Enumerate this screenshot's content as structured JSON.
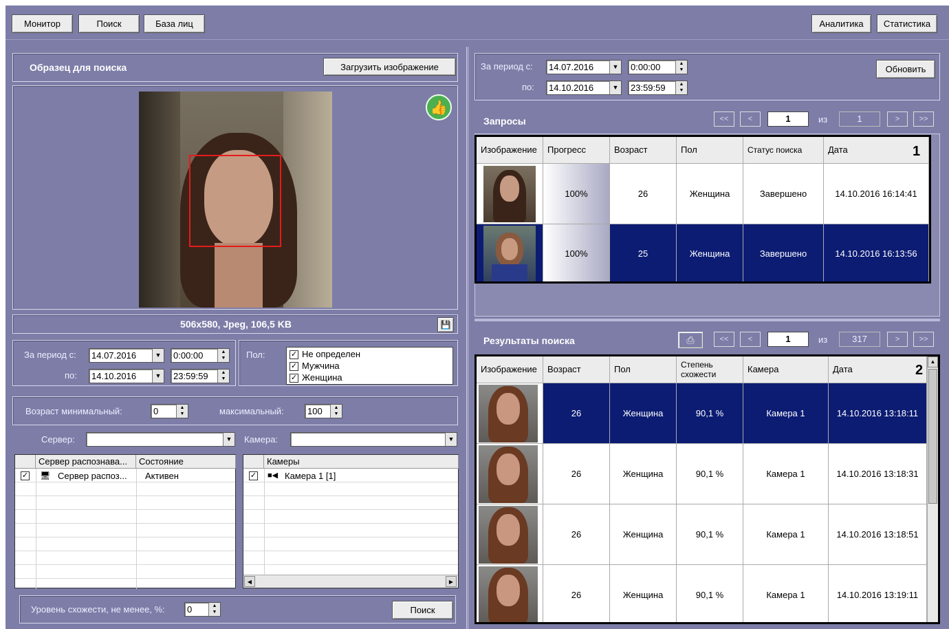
{
  "toolbar": {
    "monitor": "Монитор",
    "search": "Поиск",
    "face_base": "База лиц",
    "analytics": "Аналитика",
    "statistics": "Статистика"
  },
  "sample": {
    "title": "Образец для поиска",
    "load_button": "Загрузить изображение",
    "image_info": "506x580, Jpeg, 106,5 KB"
  },
  "left_filter": {
    "period_from_label": "За период с:",
    "date_from": "14.07.2016",
    "time_from": "0:00:00",
    "period_to_label": "по:",
    "date_to": "14.10.2016",
    "time_to": "23:59:59",
    "gender_label": "Пол:",
    "genders": [
      {
        "label": "Не определен",
        "checked": true
      },
      {
        "label": "Мужчина",
        "checked": true
      },
      {
        "label": "Женщина",
        "checked": true
      }
    ],
    "age_min_label": "Возраст минимальный:",
    "age_min": "0",
    "age_max_label": "максимальный:",
    "age_max": "100",
    "server_label": "Сервер:",
    "server_value": "",
    "camera_label": "Камера:",
    "camera_value": ""
  },
  "servers": {
    "col_server": "Сервер распознава...",
    "col_state": "Состояние",
    "rows": [
      {
        "name": "Сервер распоз...",
        "state": "Активен",
        "checked": true
      }
    ]
  },
  "cameras": {
    "col_cameras": "Камеры",
    "rows": [
      {
        "name": "Камера 1 [1]",
        "checked": true
      }
    ]
  },
  "similarity": {
    "label": "Уровень схожести, не менее, %:",
    "value": "0",
    "search_button": "Поиск"
  },
  "right_filter": {
    "period_from_label": "За период с:",
    "date_from": "14.07.2016",
    "time_from": "0:00:00",
    "period_to_label": "по:",
    "date_to": "14.10.2016",
    "time_to": "23:59:59",
    "refresh_button": "Обновить"
  },
  "requests": {
    "title": "Запросы",
    "pager": {
      "first": "<<",
      "prev": "<",
      "page": "1",
      "of": "из",
      "total": "1",
      "next": ">",
      "last": ">>"
    },
    "marker": "1",
    "columns": [
      "Изображение",
      "Прогресс",
      "Возраст",
      "Пол",
      "Статус поиска",
      "Дата"
    ],
    "rows": [
      {
        "progress": "100%",
        "age": "26",
        "gender": "Женщина",
        "status": "Завершено",
        "date": "14.10.2016 16:14:41",
        "selected": false
      },
      {
        "progress": "100%",
        "age": "25",
        "gender": "Женщина",
        "status": "Завершено",
        "date": "14.10.2016 16:13:56",
        "selected": true
      }
    ]
  },
  "results": {
    "title": "Результаты поиска",
    "pager": {
      "first": "<<",
      "prev": "<",
      "page": "1",
      "of": "из",
      "total": "317",
      "next": ">",
      "last": ">>"
    },
    "marker": "2",
    "columns": [
      "Изображение",
      "Возраст",
      "Пол",
      "Степень схожести",
      "Камера",
      "Дата"
    ],
    "rows": [
      {
        "age": "26",
        "gender": "Женщина",
        "similarity": "90,1 %",
        "camera": "Камера 1",
        "date": "14.10.2016 13:18:11",
        "selected": true
      },
      {
        "age": "26",
        "gender": "Женщина",
        "similarity": "90,1 %",
        "camera": "Камера 1",
        "date": "14.10.2016 13:18:31",
        "selected": false
      },
      {
        "age": "26",
        "gender": "Женщина",
        "similarity": "90,1 %",
        "camera": "Камера 1",
        "date": "14.10.2016 13:18:51",
        "selected": false
      },
      {
        "age": "26",
        "gender": "Женщина",
        "similarity": "90,1 %",
        "camera": "Камера 1",
        "date": "14.10.2016 13:19:11",
        "selected": false
      }
    ]
  }
}
